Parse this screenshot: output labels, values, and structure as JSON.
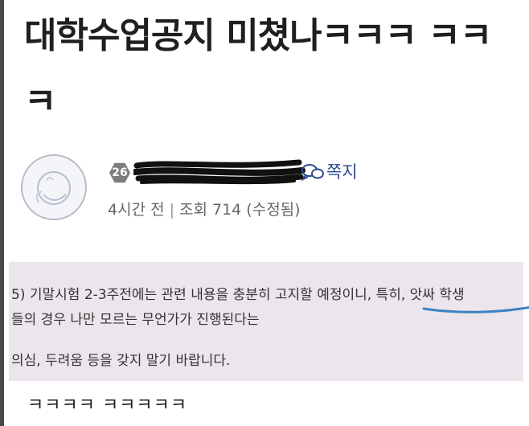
{
  "post": {
    "title": "대학수업공지 미쳤나ㅋㅋㅋ ㅋㅋㅋ"
  },
  "author": {
    "level": "26",
    "note_label": "쪽지",
    "time": "4시간 전",
    "views": "조회 714",
    "edited": "(수정됨)"
  },
  "notice": {
    "line1": "5) 기말시험 2-3주전에는 관련 내용을 충분히 고지할 예정이니, 특히, 앗싸 학생",
    "line2": "들의 경우 나만 모르는 무언가가 진행된다는",
    "line3": "의심, 두려움 등을 갖지 말기 바랍니다."
  },
  "footer_text": "ㅋㅋㅋㅋ ㅋㅋㅋㅋㅋ",
  "colors": {
    "notice_bg": "#ece6ec",
    "underline": "#3b82c4",
    "note_link": "#2b4a8f"
  }
}
